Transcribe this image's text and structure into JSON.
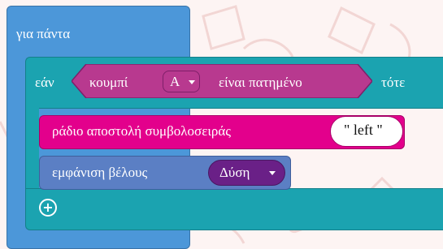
{
  "forever": {
    "label": "για πάντα"
  },
  "if_block": {
    "if_label": "εάν",
    "then_label": "τότε",
    "condition": {
      "prefix": "κουμπί",
      "button_value": "A",
      "suffix": "είναι πατημένο"
    }
  },
  "radio_block": {
    "label": "ράδιο αποστολή συμβολοσειράς",
    "string_value": "\" left \""
  },
  "arrow_block": {
    "label": "εμφάνιση βέλους",
    "direction_value": "Δύση"
  },
  "add_button": {
    "icon": "plus-circle-icon"
  },
  "colors": {
    "loops": "#4c97d9",
    "logic": "#1ba3b0",
    "input": "#b8398f",
    "radio": "#e3008c",
    "basic": "#5b7fc4",
    "dropdown": "#6a2087"
  }
}
